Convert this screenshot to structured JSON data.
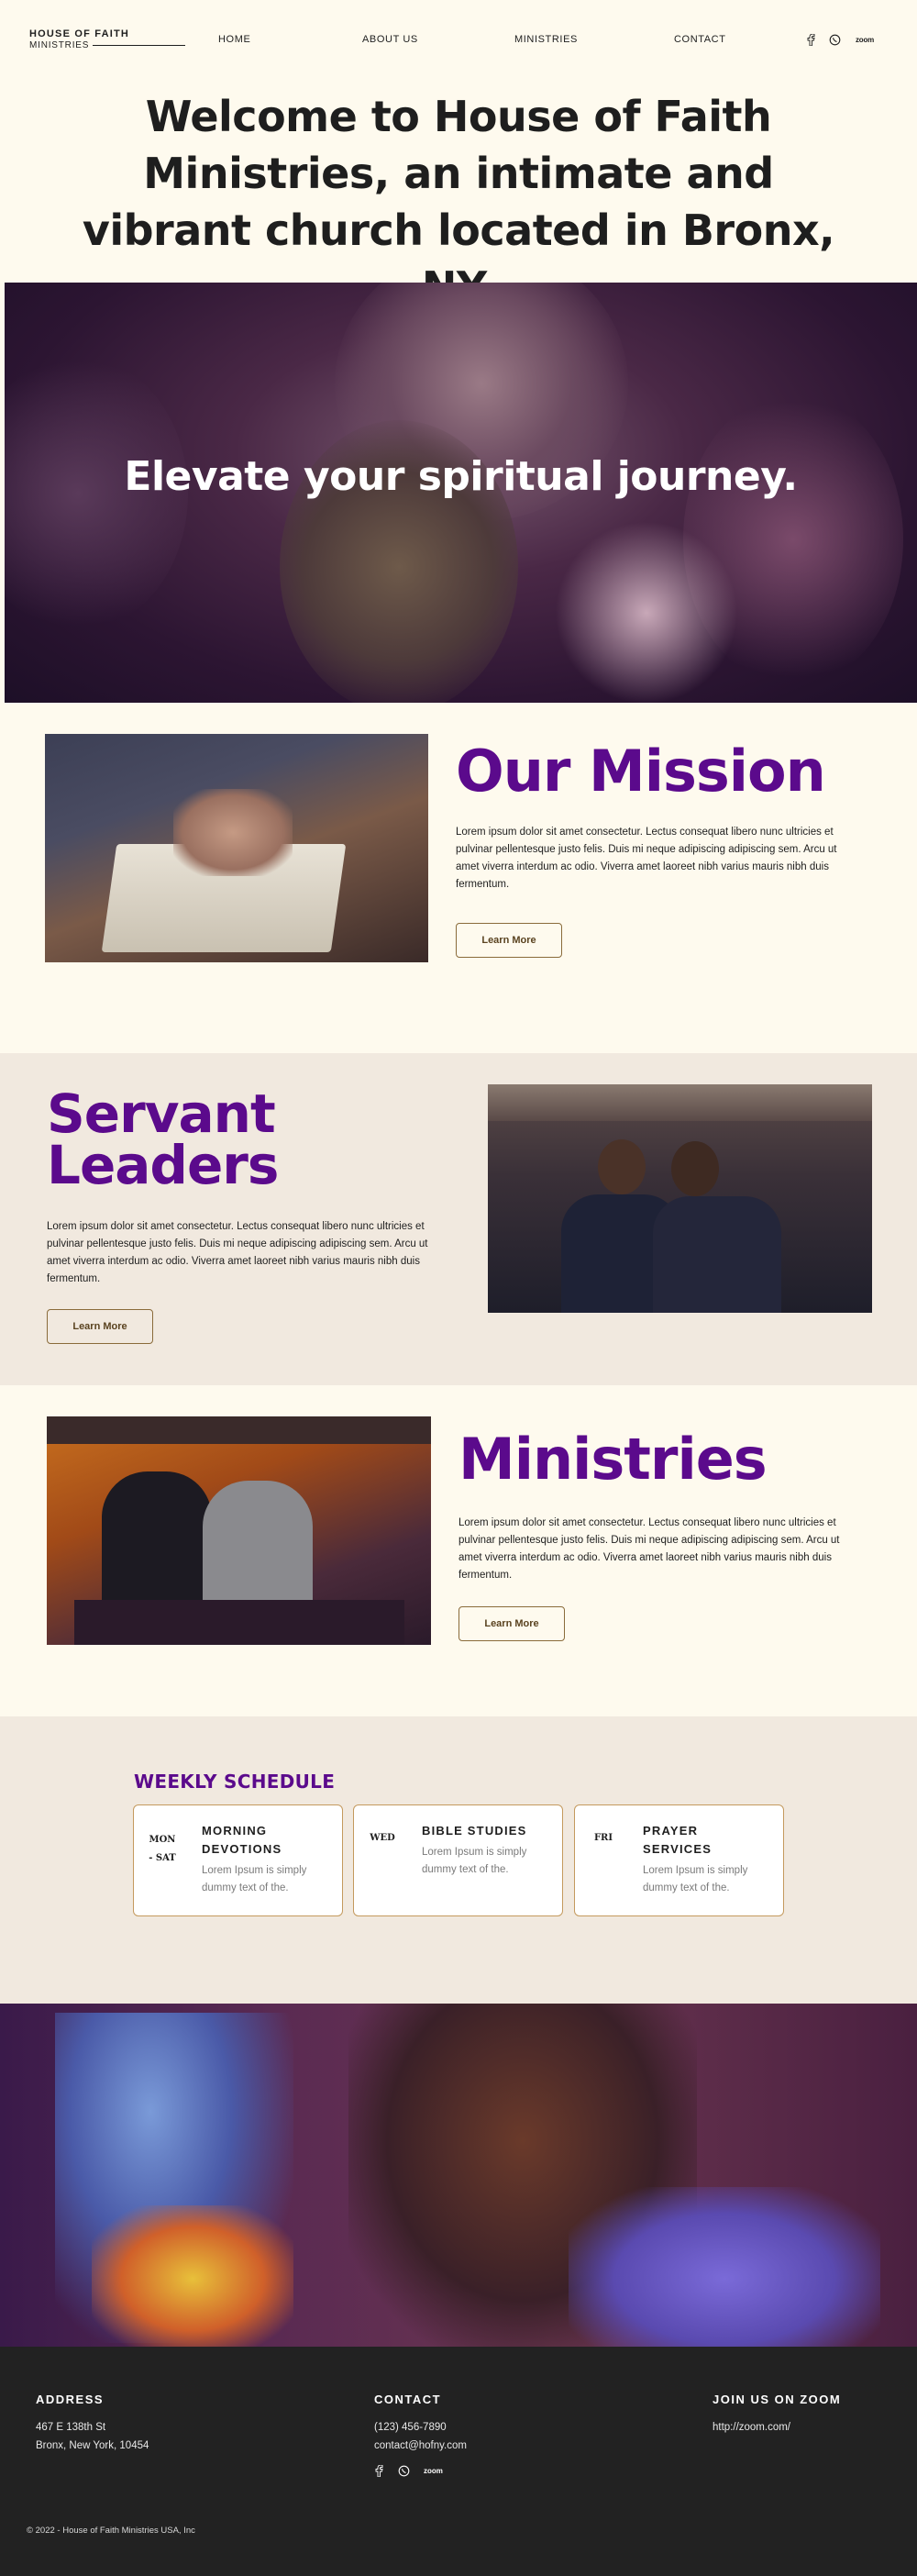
{
  "header": {
    "logo_top": "HOUSE OF FAITH",
    "logo_bottom": "MINISTRIES",
    "nav": [
      "HOME",
      "ABOUT US",
      "MINISTRIES",
      "CONTACT"
    ],
    "social_icons": [
      "facebook-icon",
      "whatsapp-icon",
      "zoom-icon"
    ],
    "zoom_label": "zoom"
  },
  "headline": "Welcome to House of Faith Ministries, an intimate and vibrant church located in Bronx, NY.",
  "hero": {
    "text": "Elevate your spiritual journey."
  },
  "mission": {
    "title": "Our Mission",
    "body": "Lorem ipsum dolor sit amet consectetur. Lectus consequat libero nunc ultricies et pulvinar pellentesque justo felis. Duis mi neque adipiscing adipiscing sem. Arcu ut amet viverra interdum ac odio. Viverra amet laoreet nibh varius mauris nibh duis fermentum.",
    "button": "Learn More"
  },
  "servant": {
    "title_line1": "Servant",
    "title_line2": "Leaders",
    "body": "Lorem ipsum dolor sit amet consectetur. Lectus consequat libero nunc ultricies et pulvinar pellentesque justo felis. Duis mi neque adipiscing adipiscing sem. Arcu ut amet viverra interdum ac odio. Viverra amet laoreet nibh varius mauris nibh duis fermentum.",
    "button": "Learn More"
  },
  "ministries": {
    "title": "Ministries",
    "body": "Lorem ipsum dolor sit amet consectetur. Lectus consequat libero nunc ultricies et pulvinar pellentesque justo felis. Duis mi neque adipiscing adipiscing sem. Arcu ut amet viverra interdum ac odio. Viverra amet laoreet nibh varius mauris nibh duis fermentum.",
    "button": "Learn More"
  },
  "schedule": {
    "title": "WEEKLY SCHEDULE",
    "cards": [
      {
        "day": "MON - SAT",
        "title": "MORNING DEVOTIONS",
        "desc": "Lorem Ipsum is simply dummy text of the."
      },
      {
        "day": "WED",
        "title": "BIBLE STUDIES",
        "desc": "Lorem Ipsum is simply dummy text of the."
      },
      {
        "day": "FRI",
        "title": "PRAYER SERVICES",
        "desc": "Lorem Ipsum is simply dummy text of the."
      }
    ]
  },
  "footer": {
    "address_head": "ADDRESS",
    "address_line1": "467 E 138th St",
    "address_line2": "Bronx, New York, 10454",
    "contact_head": "CONTACT",
    "phone": "(123) 456-7890",
    "email": "contact@hofny.com",
    "zoom_head": "JOIN US ON ZOOM",
    "zoom_link": "http://zoom.com/",
    "zoom_label": "zoom",
    "copyright": "© 2022 - House of Faith Ministries USA, Inc"
  },
  "colors": {
    "background": "#fefaee",
    "band": "#f1e9df",
    "accent_purple": "#5b0a8c",
    "button_border": "#8a6b3a",
    "card_border": "#c49a5e",
    "footer_bg": "#222222"
  }
}
